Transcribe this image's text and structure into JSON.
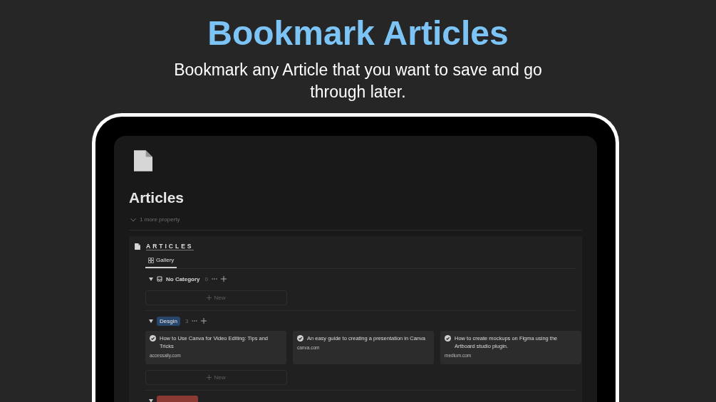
{
  "headline": "Bookmark Articles",
  "subheadline": "Bookmark any Article that you want to save and go through later.",
  "page": {
    "title": "Articles",
    "more_properties": "1 more property",
    "database": {
      "title": "ARTICLES",
      "views": [
        {
          "label": "Gallery",
          "selected": true
        }
      ],
      "groups": [
        {
          "kind": "no-category",
          "label": "No Category",
          "count": "0",
          "expanded": true,
          "new_label": "New"
        },
        {
          "kind": "tag",
          "label": "Desgin",
          "color": "#28456c",
          "count": "3",
          "expanded": true,
          "new_label": "New",
          "cards": [
            {
              "title": "How to Use Canva for Video Editing: Tips and Tricks",
              "source": "accessally.com"
            },
            {
              "title": "An easy guide to creating a presentation in Canva",
              "source": "canva.com"
            },
            {
              "title": "How to create mockups on Figma using the Artboard studio plugin.",
              "source": "medium.com"
            }
          ]
        },
        {
          "kind": "tag",
          "color": "#8a3a32",
          "expanded": true
        }
      ]
    }
  }
}
